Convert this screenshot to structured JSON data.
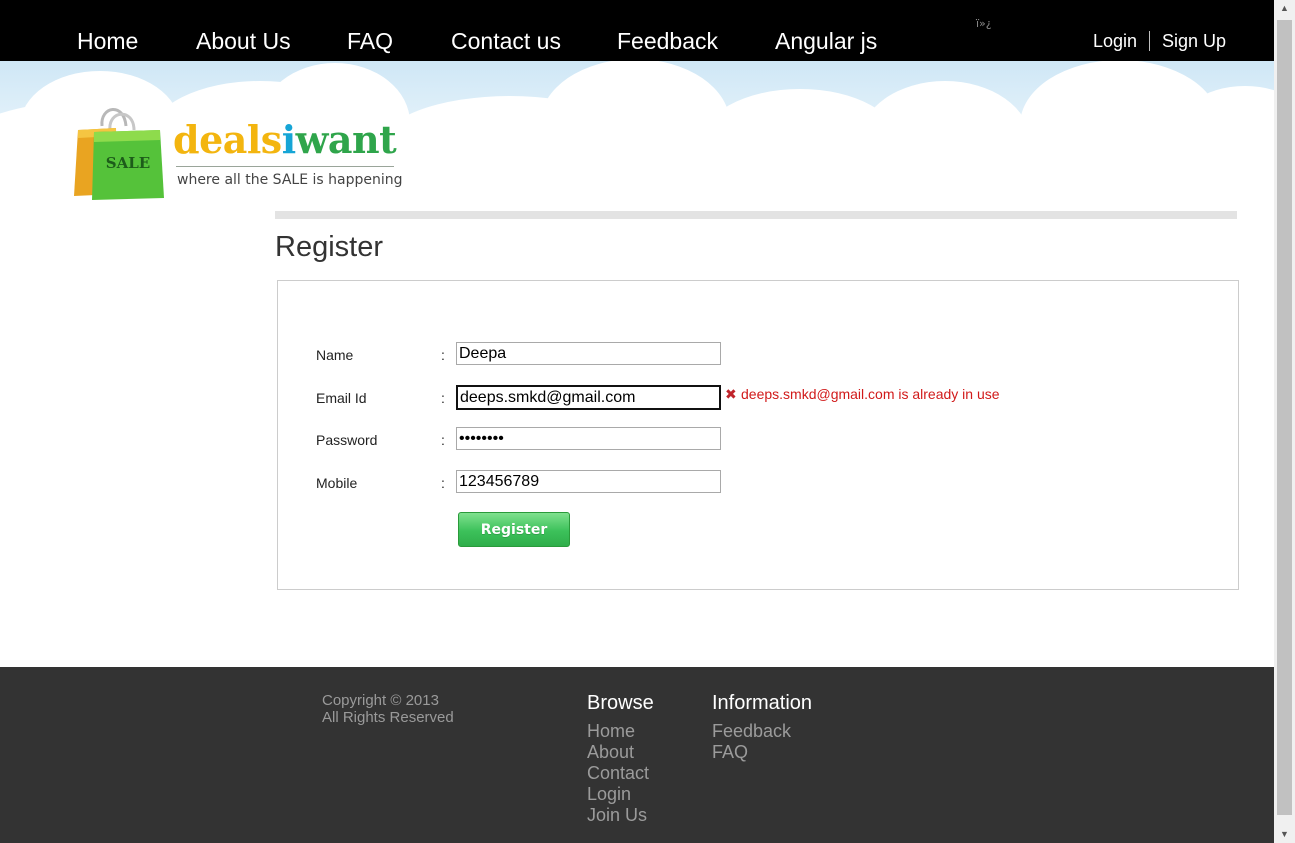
{
  "nav": {
    "items": [
      "Home",
      "About Us",
      "FAQ",
      "Contact us",
      "Feedback",
      "Angular js"
    ],
    "stray_text": "ï»¿",
    "login": "Login",
    "signup": "Sign Up"
  },
  "logo": {
    "bag_text": "SALE",
    "part1": "deals",
    "part2": "i",
    "part3": "want",
    "tagline": "where all the SALE is happening"
  },
  "register": {
    "title": "Register",
    "fields": [
      {
        "label": "Name",
        "value": "Deepa"
      },
      {
        "label": "Email Id",
        "value": "deeps.smkd@gmail.com"
      },
      {
        "label": "Password",
        "value": "••••••••"
      },
      {
        "label": "Mobile",
        "value": "123456789"
      }
    ],
    "colon": ":",
    "error_icon": "✖",
    "error_text": "deeps.smkd@gmail.com is already in use",
    "button": "Register"
  },
  "footer": {
    "copyright_line1": "Copyright © 2013",
    "copyright_line2": "All Rights Reserved",
    "browse_title": "Browse",
    "browse_links": [
      "Home",
      "About",
      "Contact",
      "Login",
      "Join Us"
    ],
    "info_title": "Information",
    "info_links": [
      "Feedback",
      "FAQ"
    ]
  },
  "colors": {
    "nav_bg": "#000000",
    "footer_bg": "#333333",
    "error": "#d11a1a",
    "button": "#3cc15a"
  },
  "icons": {
    "error": "error-x-icon",
    "bag": "shopping-bag-icon",
    "scroll_up": "scroll-up-arrow-icon",
    "scroll_down": "scroll-down-arrow-icon"
  }
}
